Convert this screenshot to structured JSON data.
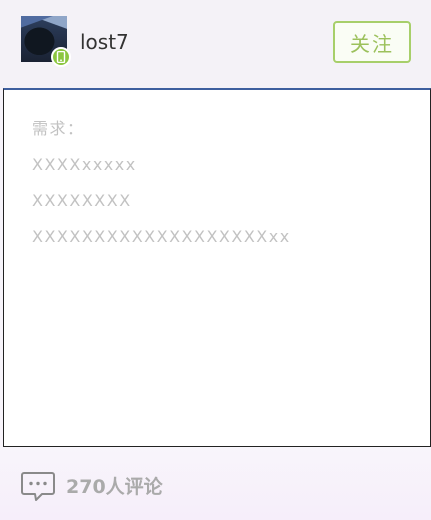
{
  "user": {
    "name": "lost7",
    "follow_label": "关注"
  },
  "post": {
    "lines": [
      "需求：",
      "XXXXxxxxx",
      "XXXXXXXX",
      "XXXXXXXXXXXXXXXXXXXxx"
    ]
  },
  "footer": {
    "comment_count": "270",
    "comment_suffix": "人评论"
  },
  "colors": {
    "follow_accent": "#a7cf6a",
    "online_badge": "#8cc640",
    "content_border_top": "#3d5f9e"
  }
}
